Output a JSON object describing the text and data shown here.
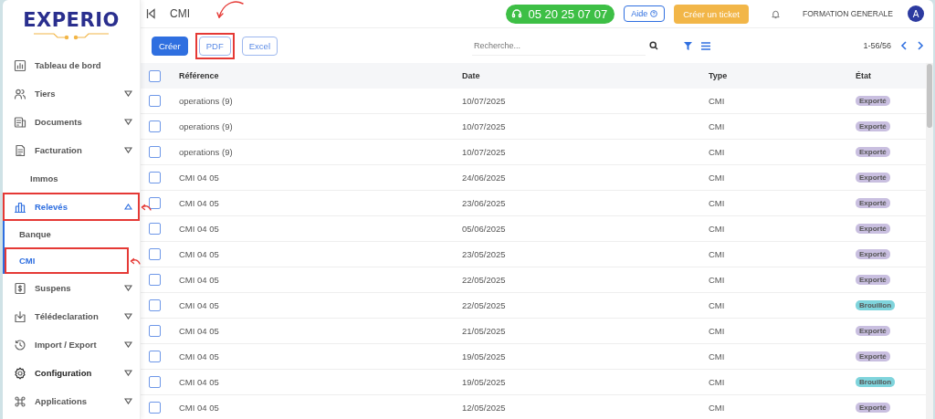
{
  "logo": {
    "text": "EXPERIO"
  },
  "sidebar": {
    "items": [
      {
        "label": "Tableau de bord",
        "kind": "main",
        "expandable": false,
        "expanded": false,
        "selected": false,
        "emphasized": false,
        "highlighted": false
      },
      {
        "label": "Tiers",
        "kind": "main",
        "expandable": true,
        "expanded": false,
        "selected": false,
        "emphasized": false,
        "highlighted": false
      },
      {
        "label": "Documents",
        "kind": "main",
        "expandable": true,
        "expanded": false,
        "selected": false,
        "emphasized": false,
        "highlighted": false
      },
      {
        "label": "Facturation",
        "kind": "main",
        "expandable": true,
        "expanded": false,
        "selected": false,
        "emphasized": false,
        "highlighted": false
      },
      {
        "label": "Immos",
        "kind": "plain",
        "expandable": false,
        "expanded": false,
        "selected": false,
        "emphasized": false,
        "highlighted": false
      },
      {
        "label": "Relevés",
        "kind": "main",
        "expandable": true,
        "expanded": true,
        "selected": true,
        "emphasized": false,
        "highlighted": true,
        "children": [
          {
            "label": "Banque",
            "selected": false,
            "highlighted": false
          },
          {
            "label": "CMI",
            "selected": true,
            "highlighted": true
          }
        ]
      },
      {
        "label": "Suspens",
        "kind": "main",
        "expandable": true,
        "expanded": false,
        "selected": false,
        "emphasized": false,
        "highlighted": false
      },
      {
        "label": "Télédeclaration",
        "kind": "main",
        "expandable": true,
        "expanded": false,
        "selected": false,
        "emphasized": false,
        "highlighted": false
      },
      {
        "label": "Import / Export",
        "kind": "main",
        "expandable": true,
        "expanded": false,
        "selected": false,
        "emphasized": false,
        "highlighted": false
      },
      {
        "label": "Configuration",
        "kind": "main",
        "expandable": true,
        "expanded": false,
        "selected": false,
        "emphasized": true,
        "highlighted": false
      },
      {
        "label": "Applications",
        "kind": "main",
        "expandable": true,
        "expanded": false,
        "selected": false,
        "emphasized": false,
        "highlighted": false
      }
    ]
  },
  "header": {
    "title": "CMI",
    "phone": "05 20 25 07 07",
    "help": "Aide",
    "ticket": "Créer un ticket",
    "company": "FORMATION GENERALE",
    "avatar": "A"
  },
  "toolbar": {
    "buttons": [
      {
        "label": "Créer",
        "kind": "primary",
        "highlighted": false
      },
      {
        "label": "PDF",
        "kind": "outline",
        "highlighted": true
      },
      {
        "label": "Excel",
        "kind": "outline",
        "highlighted": false
      }
    ],
    "search": {
      "placeholder": "Recherche..."
    },
    "pagination": "1-56/56"
  },
  "table": {
    "columns": [
      "Référence",
      "Date",
      "Type",
      "État"
    ],
    "header_checked": false,
    "rows": [
      {
        "checked": false,
        "reference": "operations (9)",
        "date": "10/07/2025",
        "type": "CMI",
        "status": "Exporté",
        "color": "#c9bfe0"
      },
      {
        "checked": false,
        "reference": "operations (9)",
        "date": "10/07/2025",
        "type": "CMI",
        "status": "Exporté",
        "color": "#c9bfe0"
      },
      {
        "checked": false,
        "reference": "operations (9)",
        "date": "10/07/2025",
        "type": "CMI",
        "status": "Exporté",
        "color": "#c9bfe0"
      },
      {
        "checked": false,
        "reference": "CMI 04 05",
        "date": "24/06/2025",
        "type": "CMI",
        "status": "Exporté",
        "color": "#c9bfe0"
      },
      {
        "checked": false,
        "reference": "CMI 04 05",
        "date": "23/06/2025",
        "type": "CMI",
        "status": "Exporté",
        "color": "#c9bfe0"
      },
      {
        "checked": false,
        "reference": "CMI 04 05",
        "date": "05/06/2025",
        "type": "CMI",
        "status": "Exporté",
        "color": "#c9bfe0"
      },
      {
        "checked": false,
        "reference": "CMI 04 05",
        "date": "23/05/2025",
        "type": "CMI",
        "status": "Exporté",
        "color": "#c9bfe0"
      },
      {
        "checked": false,
        "reference": "CMI 04 05",
        "date": "22/05/2025",
        "type": "CMI",
        "status": "Exporté",
        "color": "#c9bfe0"
      },
      {
        "checked": false,
        "reference": "CMI 04 05",
        "date": "22/05/2025",
        "type": "CMI",
        "status": "Brouillon",
        "color": "#7fd4dc"
      },
      {
        "checked": false,
        "reference": "CMI 04 05",
        "date": "21/05/2025",
        "type": "CMI",
        "status": "Exporté",
        "color": "#c9bfe0"
      },
      {
        "checked": false,
        "reference": "CMI 04 05",
        "date": "19/05/2025",
        "type": "CMI",
        "status": "Exporté",
        "color": "#c9bfe0"
      },
      {
        "checked": false,
        "reference": "CMI 04 05",
        "date": "19/05/2025",
        "type": "CMI",
        "status": "Brouillon",
        "color": "#7fd4dc"
      },
      {
        "checked": false,
        "reference": "CMI 04 05",
        "date": "12/05/2025",
        "type": "CMI",
        "status": "Exporté",
        "color": "#c9bfe0"
      }
    ]
  }
}
